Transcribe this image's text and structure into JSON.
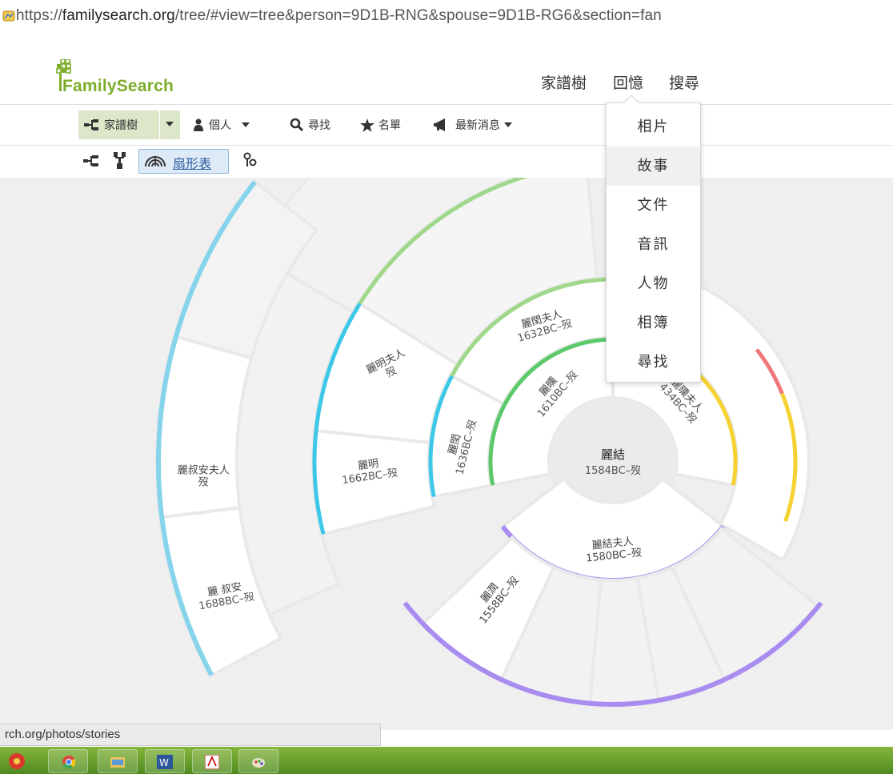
{
  "browser": {
    "url_prefix": "https://",
    "url_domain": "familysearch.org",
    "url_rest": "/tree/#view=tree&person=9D1B-RNG&spouse=9D1B-RG6&section=fan"
  },
  "header": {
    "logo_text": "FamilySearch",
    "nav": [
      "家譜樹",
      "回憶",
      "搜尋"
    ]
  },
  "toolbar": {
    "tree": "家譜樹",
    "person": "個人",
    "find": "尋找",
    "lists": "名單",
    "news": "最新消息"
  },
  "viewbar": {
    "fan_label": "扇形表"
  },
  "memories_menu": {
    "items": [
      "相片",
      "故事",
      "文件",
      "音訊",
      "人物",
      "相簿",
      "尋找"
    ],
    "highlighted": "故事"
  },
  "fan_chart": {
    "center": {
      "name": "麗結",
      "dates": "1584BC–歿"
    },
    "spouse": {
      "name": "麗結夫人",
      "dates": "1580BC–歿"
    },
    "child": {
      "name": "麗潤",
      "dates": "1558BC–歿"
    },
    "father": {
      "name": "麗曛",
      "dates": "1610BC–歿"
    },
    "mother": {
      "name": "麗曛夫人",
      "dates": "434BC–歿"
    },
    "grandfather": {
      "name": "麗閏",
      "dates": "1636BC–歿"
    },
    "grandmother": {
      "name": "麗閏夫人",
      "dates": "1632BC–歿"
    },
    "ggf": {
      "name": "麗明",
      "dates": "1662BC–歿"
    },
    "ggm": {
      "name": "麗明夫人",
      "dates": "歿"
    },
    "gggf": {
      "name": "麗 叔安",
      "dates": "1688BC–歿"
    },
    "gggm": {
      "name": "麗叔安夫人",
      "dates": "歿"
    },
    "colors": {
      "blue": "#3ec8e8",
      "green": "#5cc96a",
      "lightgreen": "#9fd88a",
      "lightblue": "#86d4ec",
      "red": "#f07878",
      "yellow": "#f5d232",
      "purple": "#a98cf0"
    }
  },
  "status_bar": {
    "text": "rch.org/photos/stories"
  }
}
